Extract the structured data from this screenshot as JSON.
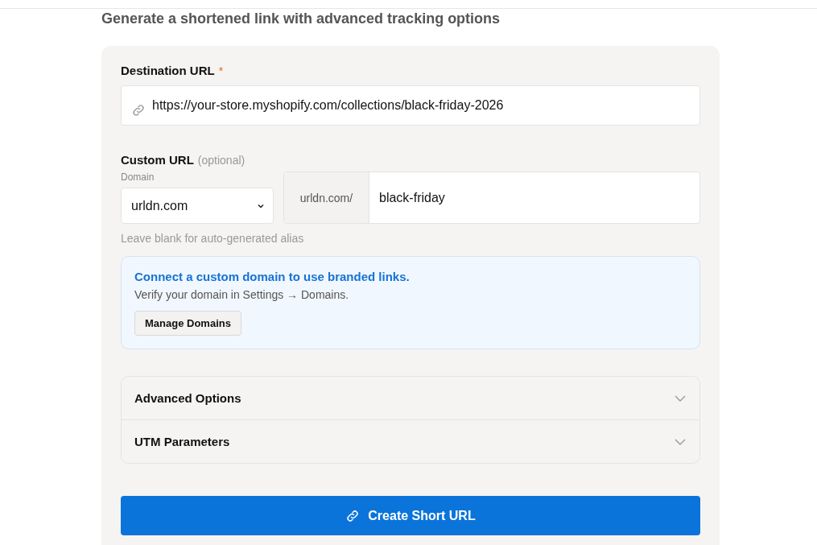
{
  "subtitle": "Generate a shortened link with advanced tracking options",
  "destination": {
    "label": "Destination URL",
    "required_mark": "*",
    "value": "https://your-store.myshopify.com/collections/black-friday-2026"
  },
  "custom_url": {
    "label": "Custom URL",
    "note": "(optional)",
    "domain_label": "Domain",
    "domain": "urldn.com",
    "prefix": "urldn.com/",
    "alias": "black-friday",
    "hint": "Leave blank for auto-generated alias"
  },
  "notice": {
    "title": "Connect a custom domain to use branded links.",
    "text": "Verify your domain in Settings → Domains.",
    "button": "Manage Domains"
  },
  "sections": [
    {
      "label": "Advanced Options",
      "expanded": false
    },
    {
      "label": "UTM Parameters",
      "expanded": false
    }
  ],
  "submit": "Create Short URL"
}
